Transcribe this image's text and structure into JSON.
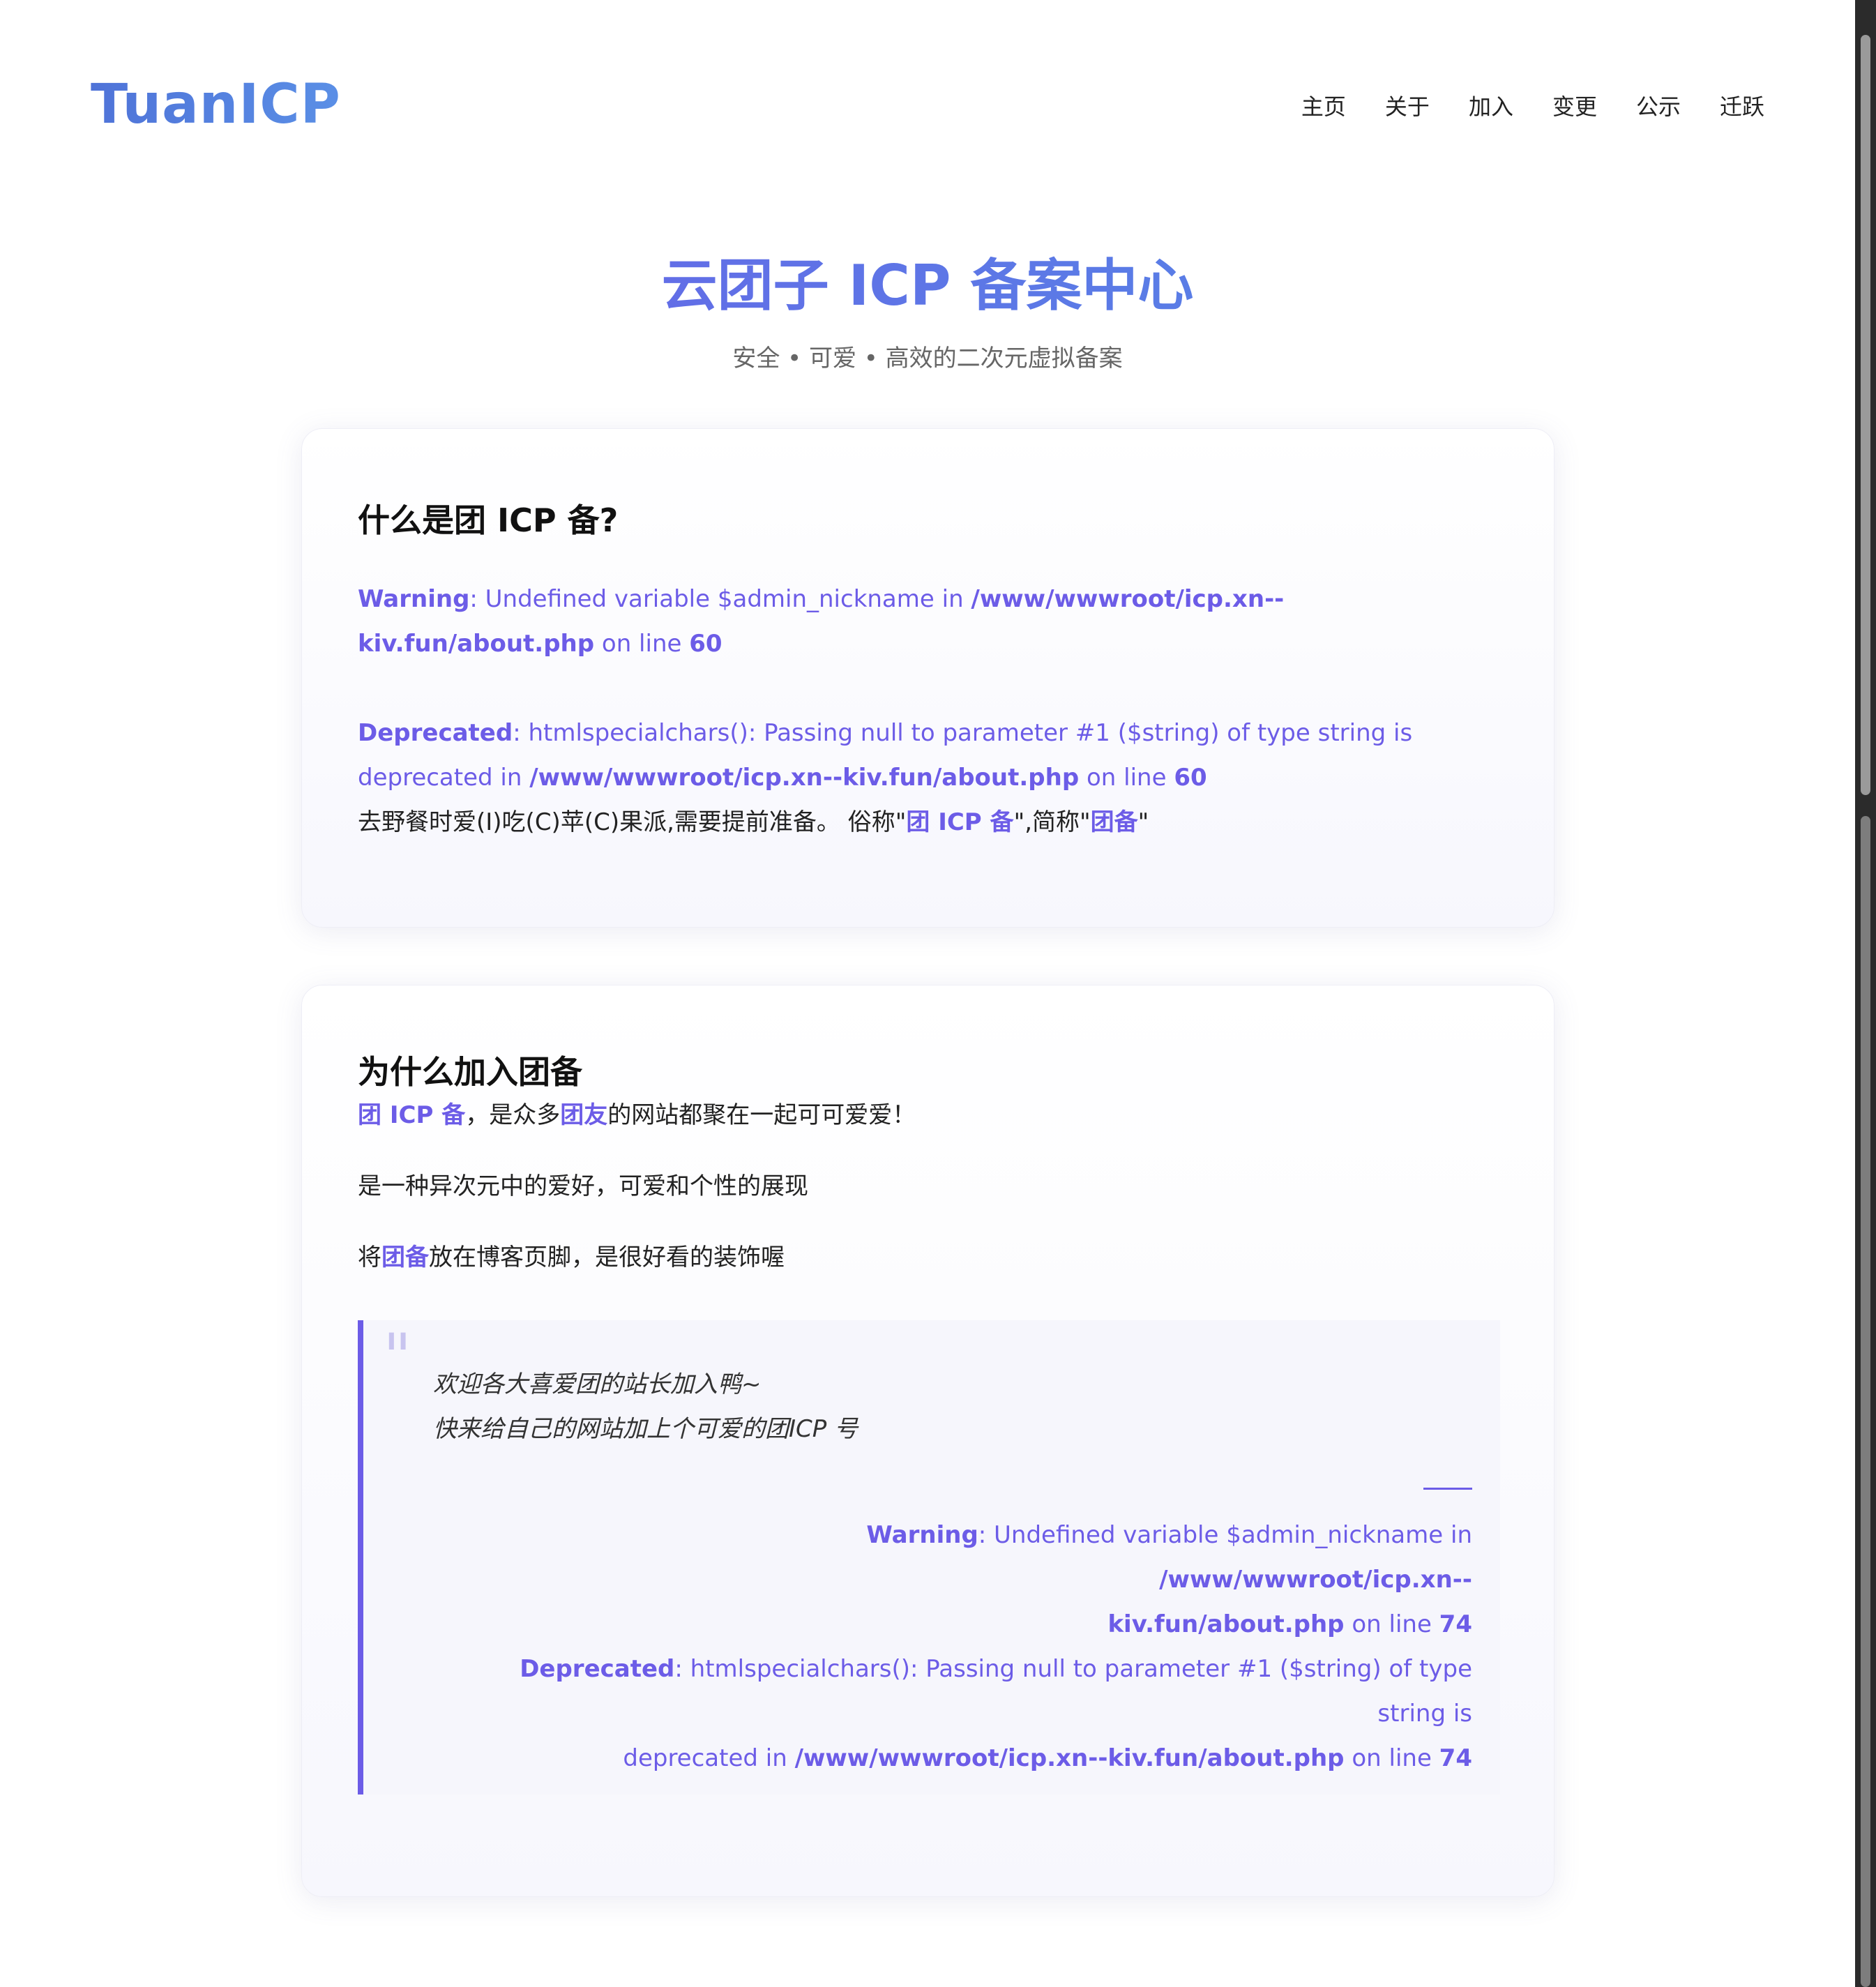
{
  "header": {
    "logo": "TuanICP",
    "nav": [
      "主页",
      "关于",
      "加入",
      "变更",
      "公示",
      "迁跃"
    ]
  },
  "hero": {
    "title": "云团子 ICP 备案中心",
    "subtitle": "安全 • 可爱 • 高效的二次元虚拟备案"
  },
  "card1": {
    "title": "什么是团 ICP 备?",
    "warning": {
      "label": "Warning",
      "text1": ": Undefined variable $admin_nickname in ",
      "path": "/www/wwwroot/icp.xn--kiv.fun/about.php",
      "text2": " on line ",
      "line": "60"
    },
    "deprecated": {
      "label": "Deprecated",
      "text1": ": htmlspecialchars(): Passing null to parameter #1 ($string) of type string is deprecated in ",
      "path": "/www/wwwroot/icp.xn--kiv.fun/about.php",
      "text2": " on line ",
      "line": "60"
    },
    "desc_prefix": "去野餐时爱(I)吃(C)苹(C)果派,需要提前准备。 俗称\"",
    "desc_hl1": "团 ICP 备",
    "desc_mid": "\",简称\"",
    "desc_hl2": "团备",
    "desc_suffix": "\""
  },
  "card2": {
    "title": "为什么加入团备",
    "line1_hl1": "团 ICP 备",
    "line1_mid": "，是众多",
    "line1_hl2": "团友",
    "line1_end": "的网站都聚在一起可可爱爱！",
    "line2": "是一种异次元中的爱好，可爱和个性的展现",
    "line3_pre": "将",
    "line3_hl": "团备",
    "line3_end": "放在博客页脚，是很好看的装饰喔",
    "quote": {
      "mark": "\"",
      "line1": "欢迎各大喜爱团的站长加入鸭~",
      "line2": "快来给自己的网站加上个可爱的团ICP 号",
      "warning": {
        "label": "Warning",
        "text1": ": Undefined variable $admin_nickname in ",
        "path1": "/www/wwwroot/icp.xn--",
        "path2": "kiv.fun/about.php",
        "text2": " on line ",
        "line": "74"
      },
      "deprecated": {
        "label": "Deprecated",
        "text1": ": htmlspecialchars(): Passing null to parameter #1 ($string) of type string is",
        "text1b": "deprecated in ",
        "path": "/www/wwwroot/icp.xn--kiv.fun/about.php",
        "text2": " on line ",
        "line": "74"
      }
    }
  },
  "colors": {
    "accent": "#6c5ce7",
    "logo": "#4f7de0",
    "text": "#222222"
  }
}
